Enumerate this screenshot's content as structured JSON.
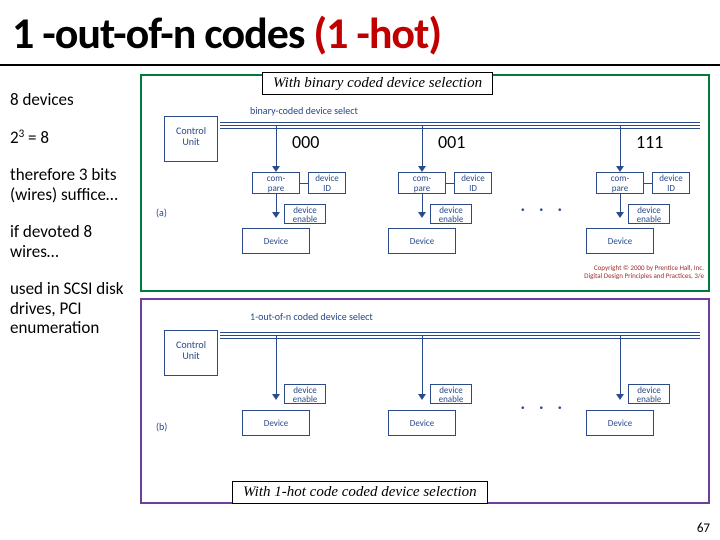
{
  "title": {
    "part1": "1 -out-of-n codes ",
    "part2": "(1 -hot)"
  },
  "left": {
    "b0": "8 devices",
    "b1_pre": "2",
    "b1_sup": "3",
    "b1_post": " = 8",
    "b2": "therefore 3 bits (wires) suffice…",
    "b3": "if devoted 8 wires…",
    "b4": "used in SCSI disk drives, PCI enumeration"
  },
  "caption_a": "With binary coded device selection",
  "caption_b": "With 1-hot code coded device selection",
  "labels": {
    "control": "Control\nUnit",
    "bus_a": "binary-coded device select",
    "bus_b": "1-out-of-n coded device select",
    "compare": "compare",
    "device_id": "device\nID",
    "device_enable": "device\nenable",
    "device": "Device",
    "sub_a": "(a)",
    "sub_b": "(b)",
    "dots": ". . ."
  },
  "bins": {
    "v0": "000",
    "v1": "001",
    "v2": "111"
  },
  "copyright": "Copyright © 2000 by Prentice Hall, Inc.\nDigital Design Principles and Practices, 3/e",
  "pagenum": "67"
}
